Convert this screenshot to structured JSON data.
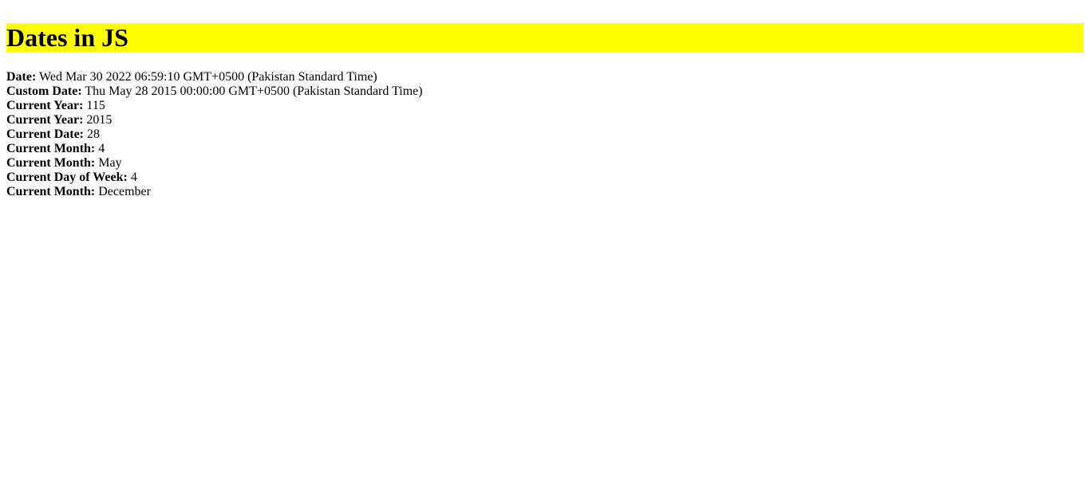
{
  "page": {
    "title": "Dates in JS",
    "title_background": "#ffff00"
  },
  "lines": [
    {
      "label": "Date:",
      "value": "Wed Mar 30 2022 06:59:10 GMT+0500 (Pakistan Standard Time)"
    },
    {
      "label": "Custom Date:",
      "value": "Thu May 28 2015 00:00:00 GMT+0500 (Pakistan Standard Time)"
    },
    {
      "label": "Current Year:",
      "value": "115"
    },
    {
      "label": "Current Year:",
      "value": "2015"
    },
    {
      "label": "Current Date:",
      "value": "28"
    },
    {
      "label": "Current Month:",
      "value": "4"
    },
    {
      "label": "Current Month:",
      "value": "May"
    },
    {
      "label": "Current Day of Week:",
      "value": "4"
    },
    {
      "label": "Current Month:",
      "value": "December"
    }
  ]
}
